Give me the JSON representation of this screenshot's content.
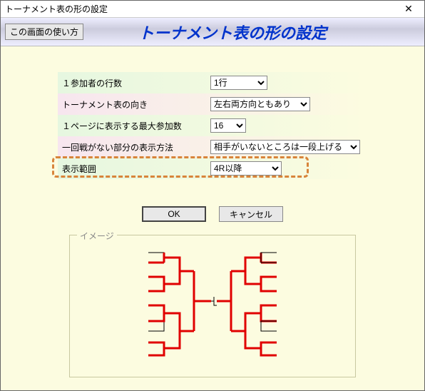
{
  "window": {
    "title": "トーナメント表の形の設定"
  },
  "header": {
    "help_label": "この画面の使い方",
    "page_title": "トーナメント表の形の設定"
  },
  "rows": {
    "participant_lines": {
      "label": "１参加者の行数",
      "value": "1行"
    },
    "direction": {
      "label": "トーナメント表の向き",
      "value": "左右両方向ともあり"
    },
    "max_per_page": {
      "label": "１ページに表示する最大参加数",
      "value": "16"
    },
    "no_first_round": {
      "label": "一回戦がない部分の表示方法",
      "value": "相手がいないところは一段上げる"
    },
    "display_range": {
      "label": "表示範囲",
      "value": "4R以降"
    }
  },
  "buttons": {
    "ok": "OK",
    "cancel": "キャンセル"
  },
  "image_group": {
    "label": "イメージ"
  }
}
